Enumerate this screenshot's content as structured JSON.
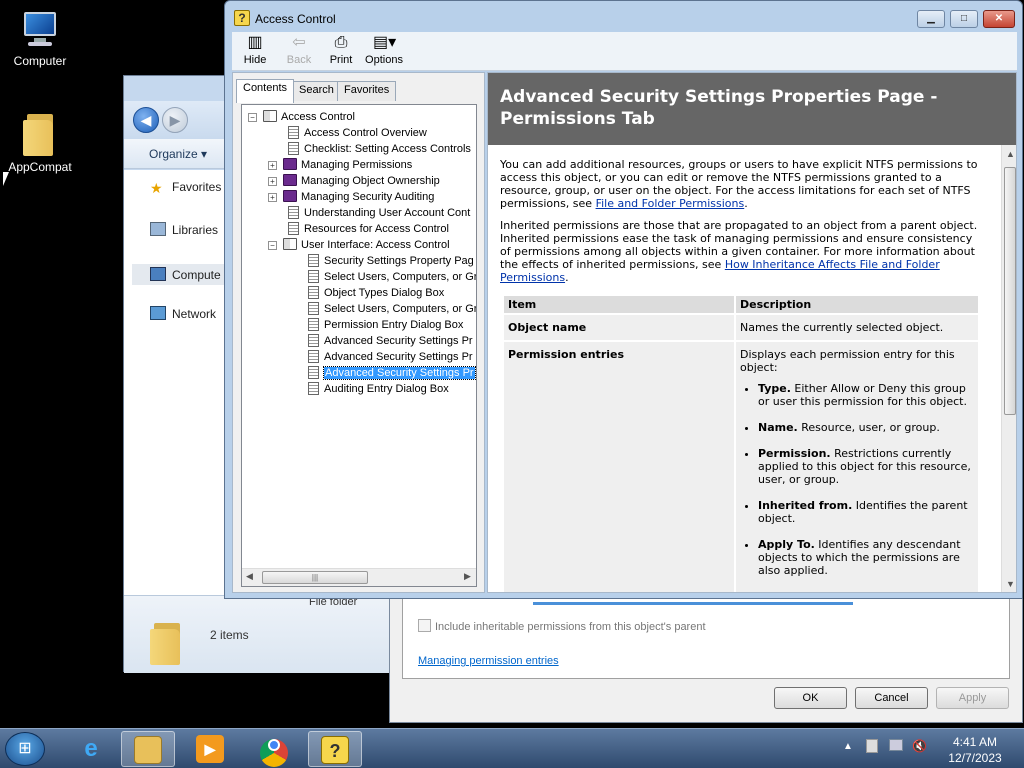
{
  "desktop": {
    "icons": [
      {
        "label": "Computer",
        "icon": "computer-icon"
      },
      {
        "label": "AppCompat",
        "icon": "folder-icon"
      }
    ]
  },
  "explorer": {
    "organize_label": "Organize ▾",
    "nav_items": [
      "Favorites",
      "Libraries",
      "Compute",
      "Network"
    ],
    "status_count": "2 items",
    "status_type": "File folder"
  },
  "security_dialog": {
    "checkbox_label": "Include inheritable permissions from this object's parent",
    "link_label": "Managing permission entries",
    "buttons": {
      "ok": "OK",
      "cancel": "Cancel",
      "apply": "Apply"
    }
  },
  "help_window": {
    "title": "Access Control",
    "title_icon": "help-icon",
    "toolbar": [
      {
        "label": "Hide",
        "icon": "hide-icon",
        "enabled": true
      },
      {
        "label": "Back",
        "icon": "back-arrow-icon",
        "enabled": false
      },
      {
        "label": "Print",
        "icon": "print-icon",
        "enabled": true
      },
      {
        "label": "Options",
        "icon": "options-icon",
        "enabled": true
      }
    ],
    "tabs": [
      {
        "label": "Contents",
        "active": true
      },
      {
        "label": "Search",
        "active": false
      },
      {
        "label": "Favorites",
        "active": false
      }
    ],
    "tree": [
      {
        "label": "Access Control",
        "level": 0,
        "type": "book-open",
        "expander": "−"
      },
      {
        "label": "Access Control Overview",
        "level": 1,
        "type": "page"
      },
      {
        "label": "Checklist: Setting Access Controls",
        "level": 1,
        "type": "page"
      },
      {
        "label": "Managing Permissions",
        "level": 1,
        "type": "book-closed",
        "expander": "+"
      },
      {
        "label": "Managing Object Ownership",
        "level": 1,
        "type": "book-closed",
        "expander": "+"
      },
      {
        "label": "Managing Security Auditing",
        "level": 1,
        "type": "book-closed",
        "expander": "+"
      },
      {
        "label": "Understanding User Account Cont",
        "level": 1,
        "type": "page"
      },
      {
        "label": "Resources for Access Control",
        "level": 1,
        "type": "page"
      },
      {
        "label": "User Interface: Access Control",
        "level": 1,
        "type": "book-open",
        "expander": "−"
      },
      {
        "label": "Security Settings Property Pag",
        "level": 2,
        "type": "page"
      },
      {
        "label": "Select Users, Computers, or Gr",
        "level": 2,
        "type": "page"
      },
      {
        "label": "Object Types Dialog Box",
        "level": 2,
        "type": "page"
      },
      {
        "label": "Select Users, Computers, or Gr",
        "level": 2,
        "type": "page"
      },
      {
        "label": "Permission Entry Dialog Box",
        "level": 2,
        "type": "page"
      },
      {
        "label": "Advanced Security Settings Pr",
        "level": 2,
        "type": "page"
      },
      {
        "label": "Advanced Security Settings Pr",
        "level": 2,
        "type": "page"
      },
      {
        "label": "Advanced Security Settings Pr",
        "level": 2,
        "type": "page",
        "selected": true
      },
      {
        "label": "Auditing Entry Dialog Box",
        "level": 2,
        "type": "page"
      }
    ],
    "content": {
      "heading": "Advanced Security Settings Properties Page - Permissions Tab",
      "para1_text": "You can add additional resources, groups or users to have explicit NTFS permissions to access this object, or you can edit or remove the NTFS permissions granted to a resource, group, or user on the object. For the access limitations for each set of NTFS permissions, see ",
      "para1_link": "File and Folder Permissions",
      "para1_end": ".",
      "para2_text": "Inherited permissions are those that are propagated to an object from a parent object. Inherited permissions ease the task of managing permissions and ensure consistency of permissions among all objects within a given container. For more information about the effects of inherited permissions, see ",
      "para2_link": "How Inheritance Affects File and Folder Permissions",
      "para2_end": ".",
      "table": {
        "headers": [
          "Item",
          "Description"
        ],
        "row1": {
          "item": "Object name",
          "desc": "Names the currently selected object."
        },
        "row2": {
          "item": "Permission entries",
          "desc": "Displays each permission entry for this object:",
          "bullets": [
            {
              "term": "Type.",
              "text": " Either Allow or Deny this group or user this permission for this object."
            },
            {
              "term": "Name.",
              "text": " Resource, user, or group."
            },
            {
              "term": "Permission.",
              "text": " Restrictions currently applied to this object for this resource, user, or group."
            },
            {
              "term": "Inherited from.",
              "text": " Identifies the parent object."
            },
            {
              "term": "Apply To.",
              "text": " Identifies any descendant objects to which the permissions are also applied."
            }
          ]
        }
      }
    }
  },
  "taskbar": {
    "apps": [
      {
        "name": "windows-explorer",
        "icon": "folder-icon",
        "active": false
      },
      {
        "name": "internet-explorer",
        "icon": "ie-icon",
        "active": false
      },
      {
        "name": "file-explorer",
        "icon": "file-explorer-icon",
        "active": true
      },
      {
        "name": "media-player",
        "icon": "media-player-icon",
        "active": false
      },
      {
        "name": "chrome",
        "icon": "chrome-icon",
        "active": false
      },
      {
        "name": "help",
        "icon": "help-icon",
        "active": true
      }
    ],
    "time": "4:41 AM",
    "date": "12/7/2023"
  }
}
